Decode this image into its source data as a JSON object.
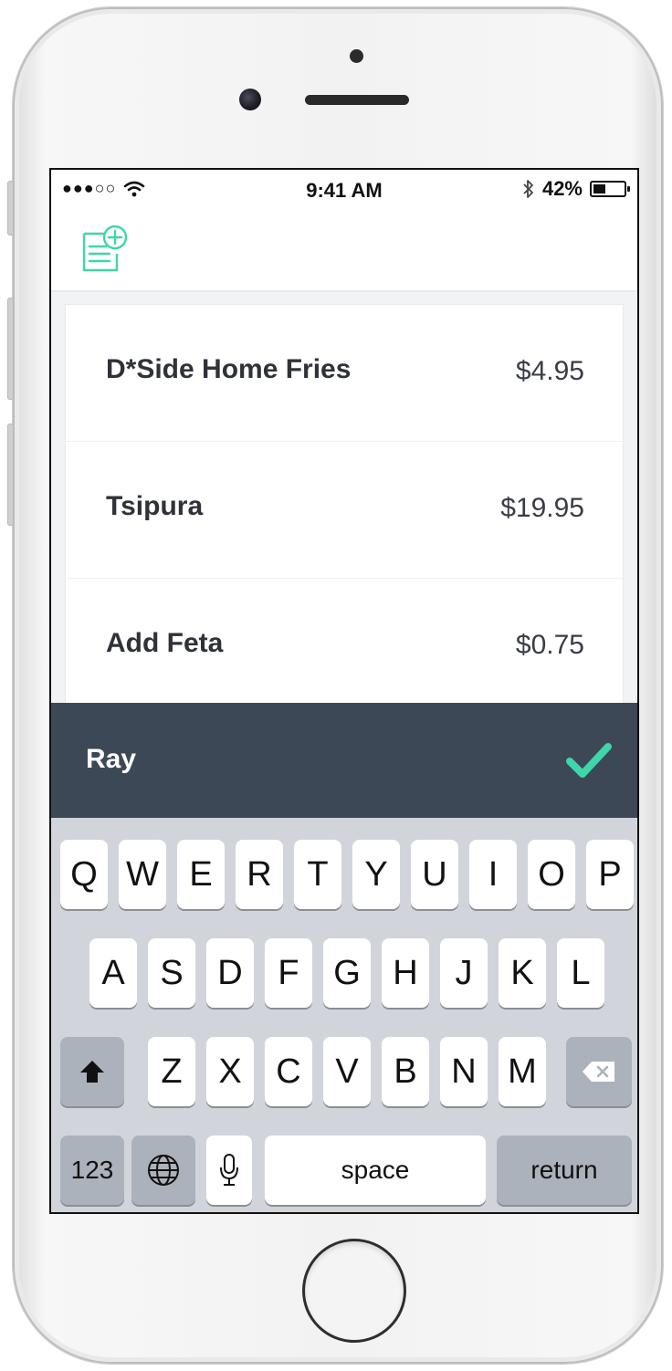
{
  "status_bar": {
    "signal": "●●●○○",
    "time": "9:41 AM",
    "battery_percent": "42%",
    "battery_level": 0.42
  },
  "header": {
    "add_icon": "add-note-icon"
  },
  "items": [
    {
      "name": "D*Side Home Fries",
      "price": "$4.95"
    },
    {
      "name": "Tsipura",
      "price": "$19.95"
    },
    {
      "name": "Add Feta",
      "price": "$0.75"
    }
  ],
  "input": {
    "value": "Ray",
    "accent_color": "#3fd6a8"
  },
  "keyboard": {
    "row1": [
      "Q",
      "W",
      "E",
      "R",
      "T",
      "Y",
      "U",
      "I",
      "O",
      "P"
    ],
    "row2": [
      "A",
      "S",
      "D",
      "F",
      "G",
      "H",
      "J",
      "K",
      "L"
    ],
    "row3": [
      "Z",
      "X",
      "C",
      "V",
      "B",
      "N",
      "M"
    ],
    "numbers_label": "123",
    "space_label": "space",
    "return_label": "return"
  }
}
